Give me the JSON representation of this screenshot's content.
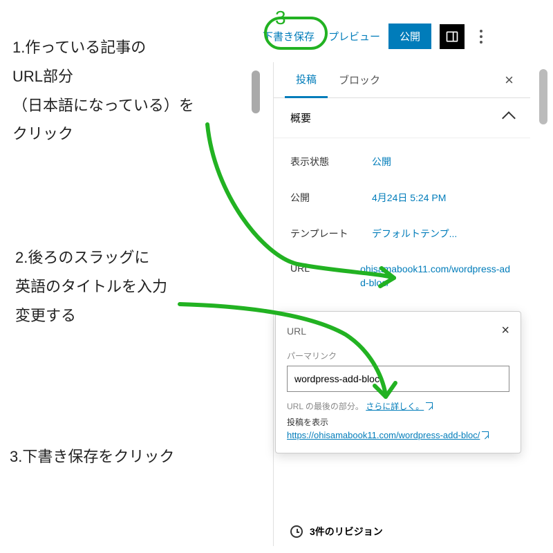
{
  "annotations": {
    "step3_number": "3",
    "step1": "1.作っている記事の\nURL部分\n（日本語になっている）を\nクリック",
    "step2": "2.後ろのスラッグに\n英語のタイトルを入力\n変更する",
    "step3": "3.下書き保存をクリック"
  },
  "toolbar": {
    "draft_save": "下書き保存",
    "preview": "プレビュー",
    "publish": "公開"
  },
  "sidebar": {
    "tabs": {
      "post": "投稿",
      "block": "ブロック"
    },
    "summary": {
      "title": "概要",
      "visibility_label": "表示状態",
      "visibility_value": "公開",
      "publish_label": "公開",
      "publish_value": "4月24日 5:24 PM",
      "template_label": "テンプレート",
      "template_value": "デフォルトテンプ...",
      "url_label": "URL",
      "url_value": "ohisamabook11.com/wordpress-add-bloc/"
    },
    "revisions": "3件のリビジョン"
  },
  "popover": {
    "title": "URL",
    "permalink_label": "パーマリンク",
    "permalink_value": "wordpress-add-bloc",
    "helper_prefix": "URL の最後の部分。 ",
    "helper_link": "さらに詳しく。",
    "view_post_label": "投稿を表示",
    "view_post_url": "https://ohisamabook11.com/wordpress-add-bloc/"
  }
}
